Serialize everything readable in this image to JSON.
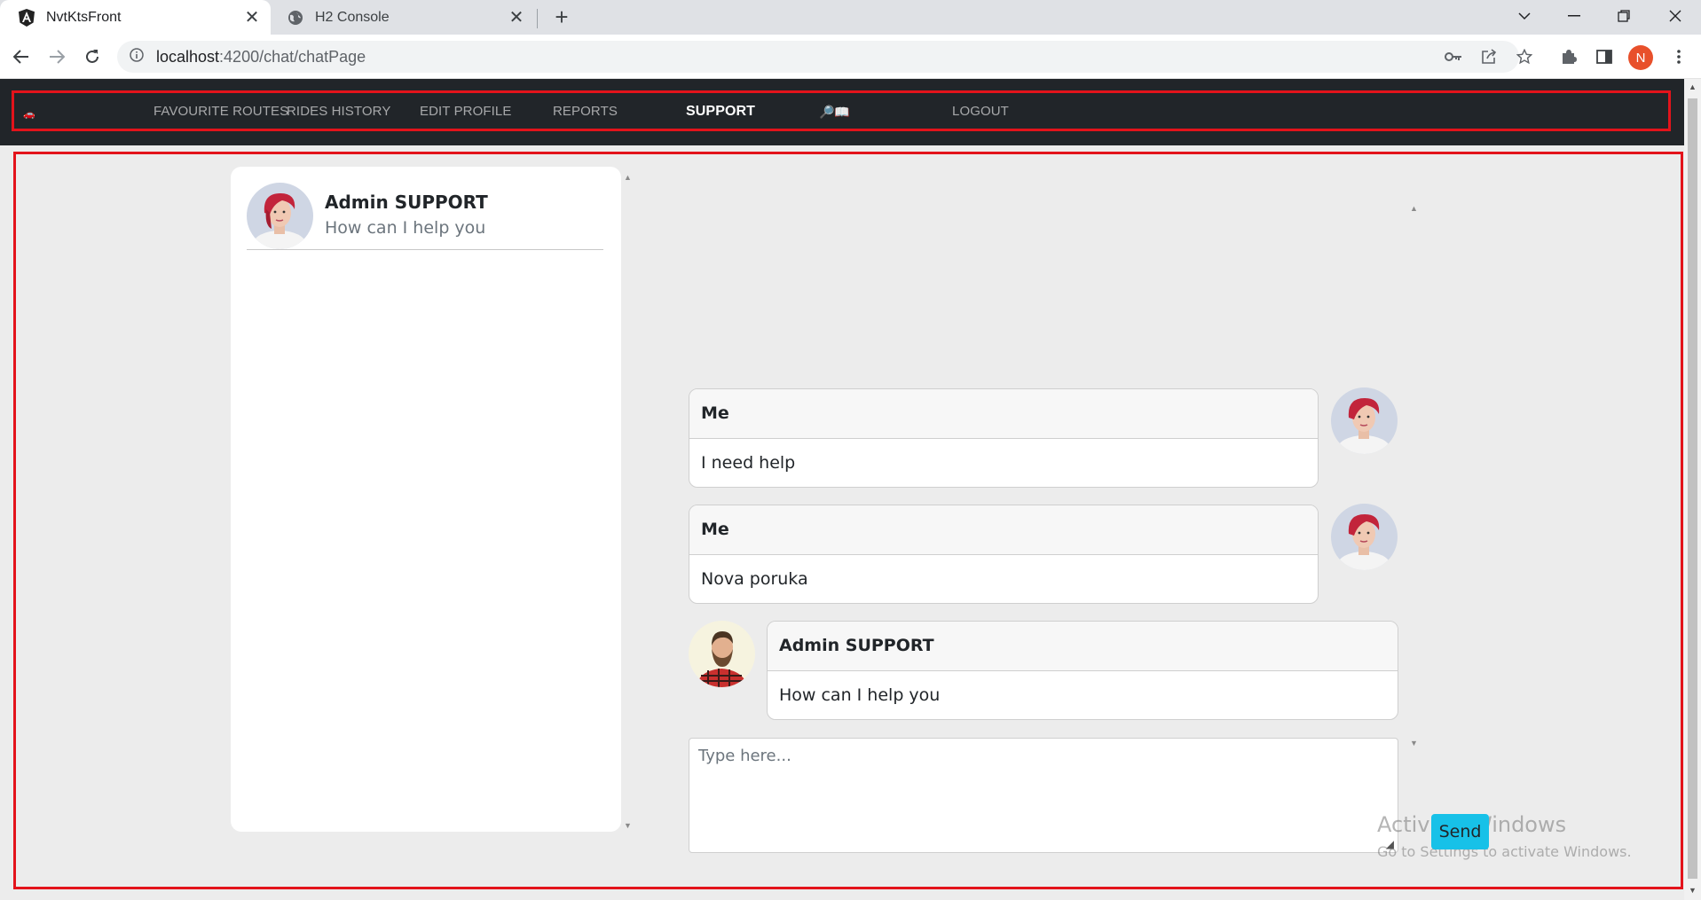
{
  "browser": {
    "tabs": [
      {
        "title": "NvtKtsFront",
        "icon": "angular-logo-icon",
        "active": true
      },
      {
        "title": "H2 Console",
        "icon": "globe-icon",
        "active": false
      }
    ],
    "new_tab": "+",
    "url_host": "localhost",
    "url_path": ":4200/chat/chatPage",
    "profile_initial": "N"
  },
  "navbar": {
    "brand": "🚗",
    "items": {
      "favourite_routes": "FAVOURITE ROUTES",
      "rides_history": "RIDES HISTORY",
      "edit_profile": "EDIT PROFILE",
      "reports": "REPORTS",
      "support": "SUPPORT",
      "emoji": "🔎📖",
      "logout": "LOGOUT"
    }
  },
  "contacts": [
    {
      "name": "Admin SUPPORT",
      "preview": "How can I help you"
    }
  ],
  "messages": [
    {
      "sender": "Me",
      "text": "I need help",
      "side": "right"
    },
    {
      "sender": "Me",
      "text": "Nova poruka",
      "side": "right"
    },
    {
      "sender": "Admin SUPPORT",
      "text": "How can I help you",
      "side": "left"
    }
  ],
  "composer": {
    "placeholder": "Type here...",
    "send_label": "Send"
  },
  "watermark": {
    "title": "Activate Windows",
    "subtitle": "Go to Settings to activate Windows."
  },
  "colors": {
    "highlight_outline": "#e3131b",
    "navbar_bg": "#212529",
    "send_button": "#17c1e8",
    "page_bg": "#ececec"
  }
}
